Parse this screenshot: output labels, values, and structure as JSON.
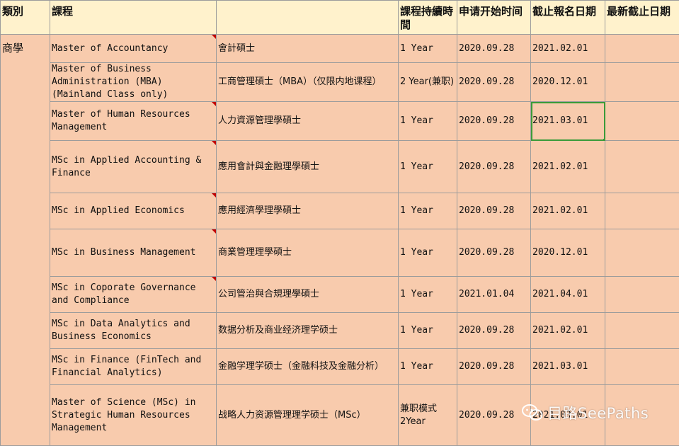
{
  "headers": {
    "category": "類別",
    "course": "課程",
    "course_cn": "",
    "duration": "課程持續時間",
    "app_start": "申请开始时间",
    "deadline": "截止報名日期",
    "latest_deadline": "最新截止日期"
  },
  "category_value": "商學",
  "rows": [
    {
      "en": "Master of Accountancy",
      "cn": "會計碩士",
      "duration": "1 Year",
      "start": "2020.09.28",
      "deadline": "2021.02.01",
      "latest": ""
    },
    {
      "en": "Master of Business Administration (MBA) (Mainland Class only)",
      "cn": "工商管理碩士（MBA）（仅限内地课程）",
      "duration": "2 Year(兼职)",
      "start": "2020.09.28",
      "deadline": "2020.12.01",
      "latest": ""
    },
    {
      "en": "Master of Human Resources Management",
      "cn": "人力資源管理學碩士",
      "duration": "1 Year",
      "start": "2020.09.28",
      "deadline": "2021.03.01",
      "latest": ""
    },
    {
      "en": "MSc in Applied Accounting & Finance",
      "cn": "應用會計與金融理學碩士",
      "duration": "1 Year",
      "start": "2020.09.28",
      "deadline": "2021.02.01",
      "latest": ""
    },
    {
      "en": "MSc in Applied Economics",
      "cn": "應用經濟學理學碩士",
      "duration": "1 Year",
      "start": "2020.09.28",
      "deadline": "2021.02.01",
      "latest": ""
    },
    {
      "en": "MSc in Business Management",
      "cn": "商業管理理學碩士",
      "duration": "1 Year",
      "start": "2020.09.28",
      "deadline": "2020.12.01",
      "latest": ""
    },
    {
      "en": "MSc in Coporate Governance and Compliance",
      "cn": "公司管治與合規理學碩士",
      "duration": "1 Year",
      "start": "2021.01.04",
      "deadline": "2021.04.01",
      "latest": ""
    },
    {
      "en": "MSc in Data Analytics and Business Economics",
      "cn": "数据分析及商业经济理学硕士",
      "duration": "1 Year",
      "start": "2020.09.28",
      "deadline": "2021.02.01",
      "latest": ""
    },
    {
      "en": "MSc in Finance (FinTech and Financial Analytics)",
      "cn": "金融学理学硕士（金融科技及金融分析）",
      "duration": "1 Year",
      "start": "2020.09.28",
      "deadline": "2021.03.01",
      "latest": ""
    },
    {
      "en": "Master of Science (MSc) in Strategic Human Resources Management",
      "cn": "战略人力资源管理理学硕士（MSc）",
      "duration": "兼职模式 2Year",
      "start": "2020.09.28",
      "deadline": "2021.03.01",
      "latest": ""
    }
  ],
  "watermark": {
    "text": "目路SeePaths",
    "icon": "wechat-icon"
  },
  "colors": {
    "header_bg": "#fff2cc",
    "row_bg": "#f8cbad",
    "selection": "#3a9b3a",
    "comment_mark": "#c00000"
  }
}
